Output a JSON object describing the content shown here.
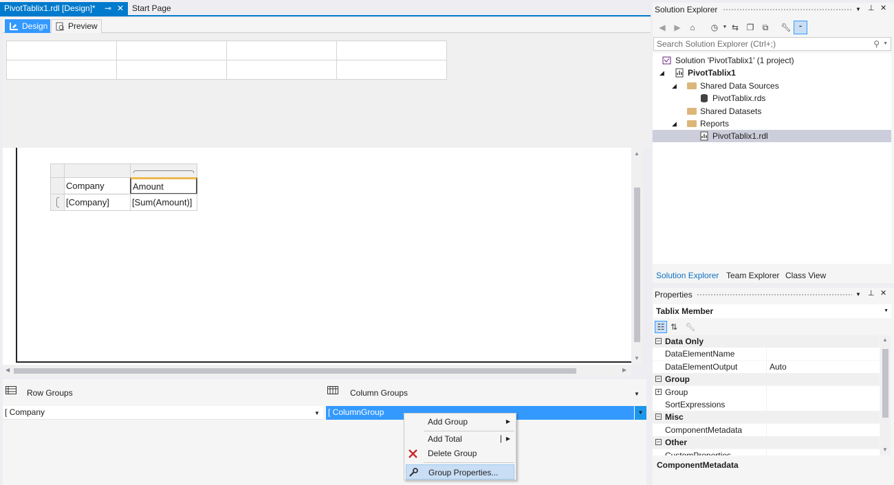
{
  "doc_tabs": {
    "active": "PivotTablix1.rdl [Design]*",
    "second": "Start Page"
  },
  "view_bar": {
    "design": "Design",
    "preview": "Preview"
  },
  "tablix": {
    "header_company": "Company",
    "header_amount": "Amount",
    "data_company": "[Company]",
    "data_amount": "[Sum(Amount)]"
  },
  "groups": {
    "row_title": "Row Groups",
    "column_title": "Column Groups",
    "row_item": "Company",
    "column_item": "ColumnGroup"
  },
  "context_menu": {
    "add_group": "Add Group",
    "add_total": "Add Total",
    "delete_group": "Delete Group",
    "group_properties": "Group Properties..."
  },
  "solution_explorer": {
    "title": "Solution Explorer",
    "search_placeholder": "Search Solution Explorer (Ctrl+;)",
    "tree": {
      "solution": "Solution 'PivotTablix1' (1 project)",
      "project": "PivotTablix1",
      "shared_data_sources": "Shared Data Sources",
      "data_source": "PivotTablix.rds",
      "shared_datasets": "Shared Datasets",
      "reports": "Reports",
      "report": "PivotTablix1.rdl"
    },
    "tabs": {
      "solution_explorer": "Solution Explorer",
      "team_explorer": "Team Explorer",
      "class_view": "Class View"
    }
  },
  "properties": {
    "title": "Properties",
    "object": "Tablix Member",
    "categories": {
      "data_only": "Data Only",
      "group": "Group",
      "misc": "Misc",
      "other": "Other"
    },
    "rows": {
      "data_element_name": "DataElementName",
      "data_element_output": "DataElementOutput",
      "data_element_output_value": "Auto",
      "group": "Group",
      "sort_expressions": "SortExpressions",
      "component_metadata": "ComponentMetadata",
      "custom_properties": "CustomProperties"
    },
    "description": "ComponentMetadata"
  },
  "colors": {
    "accent": "#007acc",
    "selection": "#3399ff",
    "highlight": "#f0b84b"
  }
}
